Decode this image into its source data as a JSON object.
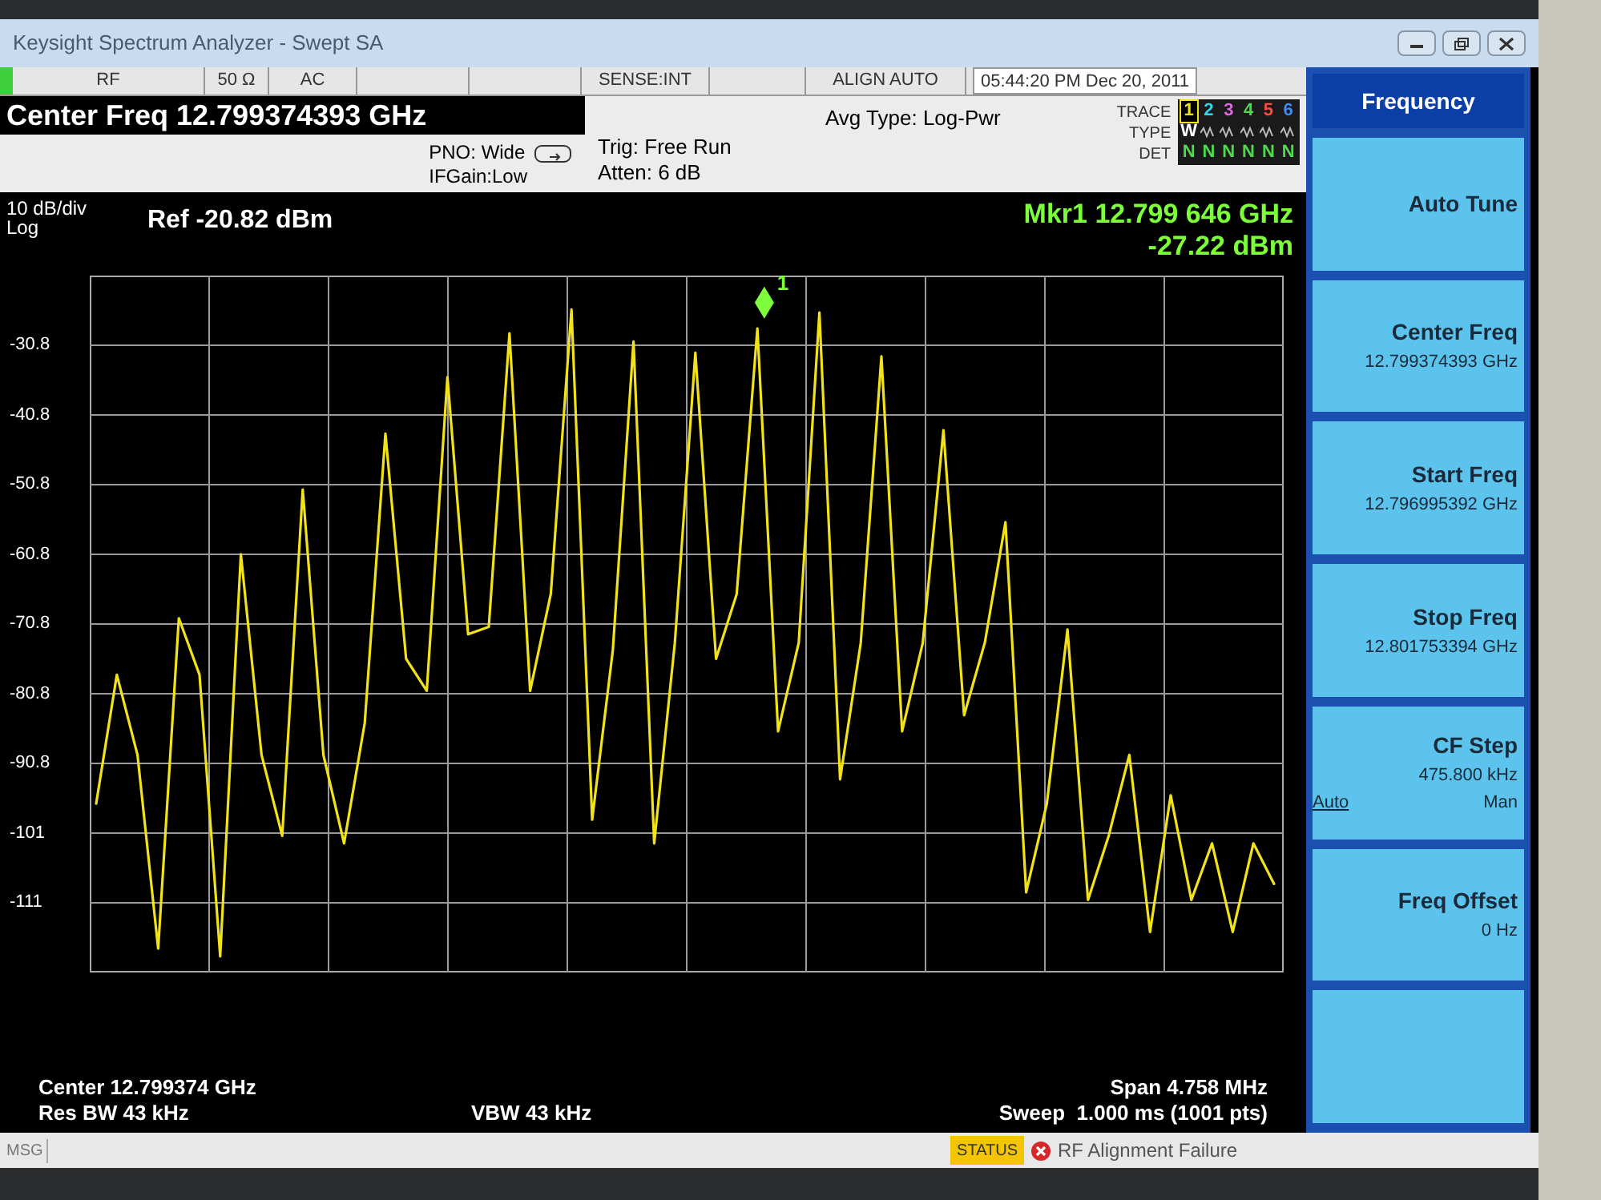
{
  "window": {
    "title": "Keysight Spectrum Analyzer - Swept SA"
  },
  "status_row": {
    "cells": [
      "RF",
      "50 Ω",
      "AC",
      "",
      "",
      "SENSE:INT",
      "",
      "ALIGN AUTO"
    ],
    "time": "05:44:20 PM",
    "date": "Dec 20, 2011"
  },
  "header": {
    "center_freq": "Center Freq 12.799374393 GHz",
    "pno": "PNO: Wide",
    "if_gain": "IFGain:Low",
    "trig": "Trig: Free Run",
    "atten": "Atten: 6 dB",
    "avg_type": "Avg Type: Log-Pwr"
  },
  "trace_panel": {
    "trace_label": "TRACE",
    "type_label": "TYPE",
    "det_label": "DET",
    "traces": [
      {
        "number": "1",
        "color": "#f2e21a",
        "selected": true,
        "type": "W",
        "det": "N"
      },
      {
        "number": "2",
        "color": "#33d6e6",
        "selected": false,
        "det": "N"
      },
      {
        "number": "3",
        "color": "#e066e6",
        "selected": false,
        "det": "N"
      },
      {
        "number": "4",
        "color": "#4ddb4d",
        "selected": false,
        "det": "N"
      },
      {
        "number": "5",
        "color": "#ff4d3d",
        "selected": false,
        "det": "N"
      },
      {
        "number": "6",
        "color": "#3d8cff",
        "selected": false,
        "det": "N"
      }
    ]
  },
  "graph": {
    "scale": "10 dB/div",
    "scale_type": "Log",
    "ref": "Ref -20.82 dBm",
    "marker_freq": "Mkr1 12.799 646 GHz",
    "marker_level": "-27.22 dBm",
    "marker_label": "1",
    "chart_data": {
      "type": "line",
      "grid": true,
      "ylim": [
        -120.82,
        -20.82
      ],
      "yticks": [
        -30.8,
        -40.8,
        -50.8,
        -60.8,
        -70.8,
        -80.8,
        -90.8,
        {
          "value": -100.8,
          "label": "-101"
        },
        {
          "value": -110.8,
          "label": "-111"
        }
      ],
      "series": [
        {
          "color": "#f2e21a",
          "values": [
            -96.6,
            -78.1,
            -89.6,
            -117.4,
            -70,
            -78.1,
            -118.5,
            -60.8,
            -89.6,
            -101.2,
            -51.5,
            -89.6,
            -102.3,
            -85,
            -43.5,
            -75.8,
            -80.4,
            -35.4,
            -72.3,
            -71.2,
            -29.1,
            -80.4,
            -66.5,
            -25.7,
            -98.9,
            -74.6,
            -30.3,
            -102.3,
            -73.5,
            -31.9,
            -75.8,
            -66.5,
            -28.4,
            -86.2,
            -73.5,
            -26.1,
            -93.1,
            -73.5,
            -32.4,
            -86.2,
            -73.5,
            -43,
            -83.9,
            -73.5,
            -56.2,
            -109.3,
            -96.6,
            -71.6,
            -110.4,
            -101.2,
            -89.6,
            -115,
            -95.4,
            -110.4,
            -102.3,
            -115,
            -102.3,
            -108.1
          ]
        }
      ]
    }
  },
  "footer": {
    "center": "Center 12.799374 GHz",
    "res_bw": "Res BW 43 kHz",
    "vbw": "VBW 43 kHz",
    "span": "Span 4.758 MHz",
    "sweep": "Sweep  1.000 ms (1001 pts)"
  },
  "message_bar": {
    "label": "MSG",
    "status": "STATUS",
    "message": "RF Alignment Failure"
  },
  "softkeys": [
    {
      "kind": "title",
      "label": "Frequency"
    },
    {
      "kind": "action",
      "label": "Auto Tune"
    },
    {
      "kind": "value",
      "label": "Center Freq",
      "value": "12.799374393 GHz"
    },
    {
      "kind": "value",
      "label": "Start Freq",
      "value": "12.796995392 GHz"
    },
    {
      "kind": "value",
      "label": "Stop Freq",
      "value": "12.801753394 GHz"
    },
    {
      "kind": "toggle",
      "label": "CF Step",
      "value": "475.800 kHz",
      "left": "Auto",
      "right": "Man"
    },
    {
      "kind": "value",
      "label": "Freq Offset",
      "value": "0 Hz"
    },
    {
      "kind": "blank"
    }
  ]
}
